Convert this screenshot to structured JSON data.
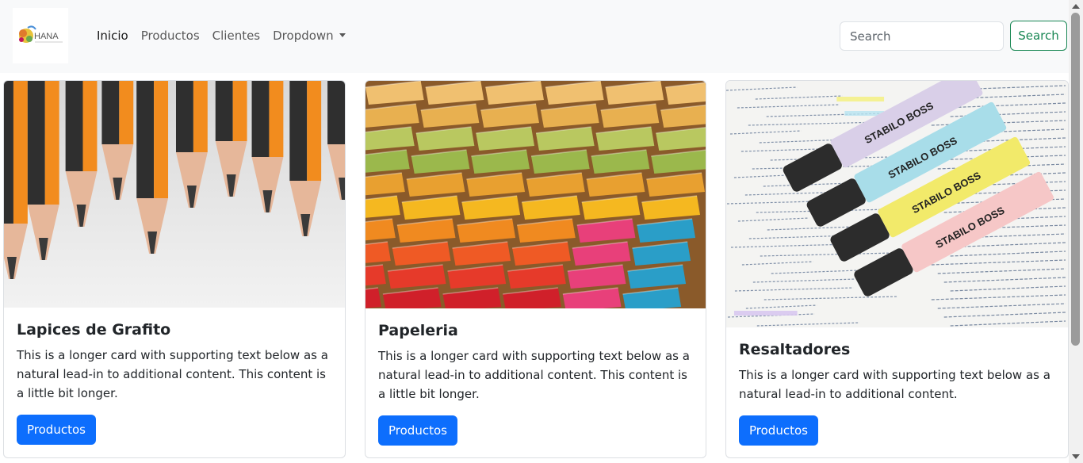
{
  "navbar": {
    "brand_text": "HANA",
    "links": [
      {
        "label": "Inicio",
        "active": true
      },
      {
        "label": "Productos",
        "active": false
      },
      {
        "label": "Clientes",
        "active": false
      },
      {
        "label": "Dropdown",
        "active": false
      }
    ],
    "search": {
      "placeholder": "Search",
      "button_label": "Search"
    }
  },
  "cards": [
    {
      "title": "Lapices de Grafito",
      "text": "This is a longer card with supporting text below as a natural lead-in to additional content. This content is a little bit longer.",
      "button_label": "Productos",
      "image": "graphite-pencils-photo"
    },
    {
      "title": "Papeleria",
      "text": "This is a longer card with supporting text below as a natural lead-in to additional content. This content is a little bit longer.",
      "button_label": "Productos",
      "image": "colored-paper-stacks-photo"
    },
    {
      "title": "Resaltadores",
      "text": "This is a longer card with supporting text below as a natural lead-in to additional content.",
      "button_label": "Productos",
      "image": "highlighter-markers-photo",
      "marker_brand_text": "STABILO BOSS"
    }
  ],
  "colors": {
    "primary": "#0d6efd",
    "success": "#198754",
    "navbar_bg": "#f8f9fa"
  }
}
